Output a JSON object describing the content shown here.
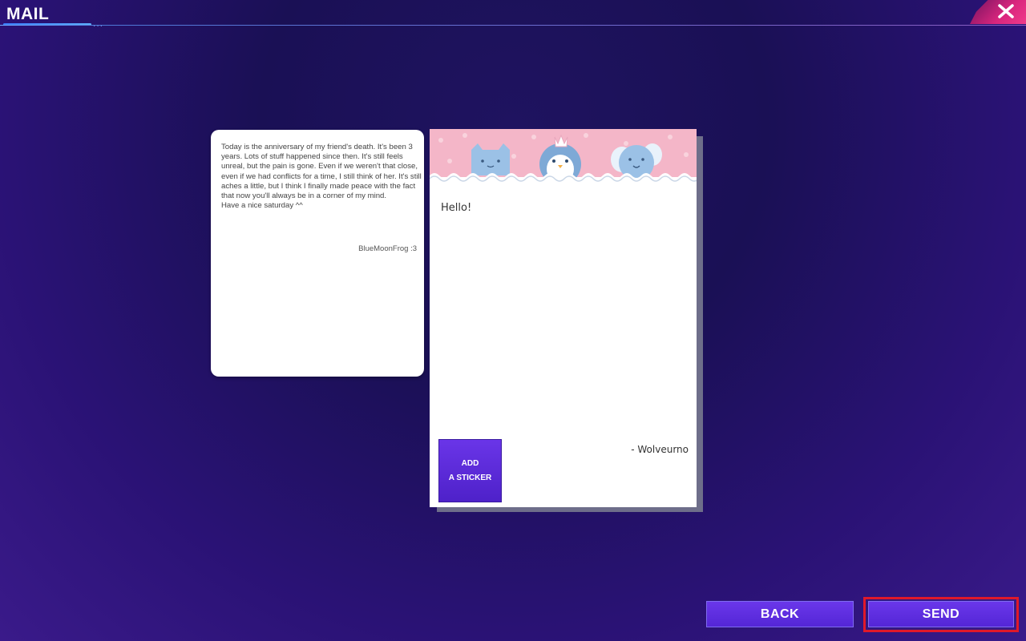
{
  "header": {
    "title": "MAIL",
    "close_icon": "close-icon"
  },
  "received_letter": {
    "body": "Today is the anniversary of my friend's death. It's been 3 years. Lots of stuff happened since then. It's still feels unreal, but the pain is gone. Even if we weren't that close, even if we had conflicts for a time, I still think of her. It's still aches a little, but I think I finally made peace with the fact that now you'll always be in a corner of my mind.\nHave a nice saturday ^^",
    "signature": "BlueMoonFrog :3"
  },
  "reply": {
    "text": "Hello!",
    "signature": "- Wolveurno",
    "sticker_button": {
      "line1": "ADD",
      "line2": "A STICKER"
    }
  },
  "actions": {
    "back_label": "BACK",
    "send_label": "SEND"
  },
  "colors": {
    "accent_button": "#5a2be0",
    "highlight": "#e0192a",
    "paper_header": "#f4b6c8"
  }
}
